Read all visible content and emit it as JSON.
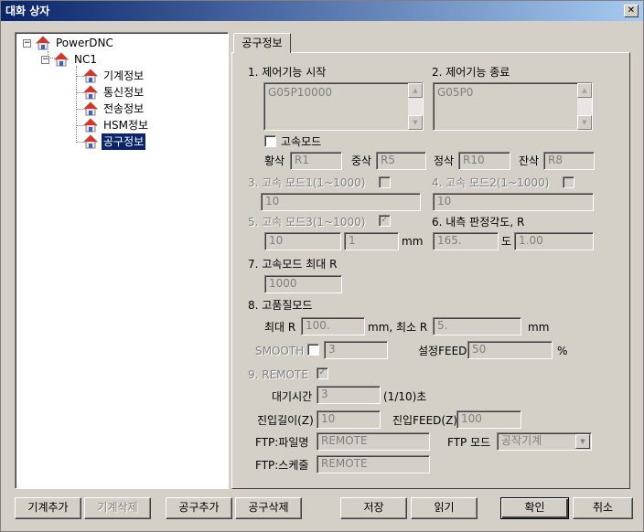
{
  "window": {
    "title": "대화 상자",
    "close_glyph": "✕"
  },
  "tree": {
    "root": "PowerDNC",
    "machine": "NC1",
    "items": [
      "기계정보",
      "통신정보",
      "전송정보",
      "HSM정보",
      "공구정보"
    ],
    "selected_index": 4,
    "expander_glyph": "−"
  },
  "tab": {
    "label": "공구정보"
  },
  "form": {
    "start_label": "1. 제어기능 시작",
    "start_value": "G05P10000",
    "end_label": "2. 제어기능 종료",
    "end_value": "G05P0",
    "high_speed_mode_label": "고속모드",
    "rough_label": "황삭",
    "rough_value": "R1",
    "semi_label": "중삭",
    "semi_value": "R5",
    "finish_label": "정삭",
    "finish_value": "R10",
    "rest_label": "잔삭",
    "rest_value": "R8",
    "mode1_label": "3. 고속 모드1(1~1000)",
    "mode1_value": "10",
    "mode2_label": "4. 고속 모드2(1~1000)",
    "mode2_value": "10",
    "mode3_label": "5. 고속 모드3(1~1000)",
    "mode3_value1": "10",
    "mode3_value2": "1",
    "mode3_unit": "mm",
    "angle_label": "6. 내측 판정각도, R",
    "angle_value": "165.",
    "angle_unit": "도",
    "angle_r_value": "1.00",
    "max_r_label": "7. 고속모드 최대 R",
    "max_r_value": "1000",
    "quality_label": "8. 고품질모드",
    "quality_max_label": "최대 R",
    "quality_max_value": "100.",
    "quality_max_unit": "mm, 최소 R",
    "quality_min_value": "5.",
    "quality_min_unit": "mm",
    "smooth_label": "SMOOTH",
    "smooth_value": "3",
    "feed_label": "설정FEED",
    "feed_value": "50",
    "feed_unit": "%",
    "remote_label": "9. REMOTE",
    "wait_label": "대기시간",
    "wait_value": "3",
    "wait_unit": "(1/10)초",
    "approach_z_label": "진입길이(Z)",
    "approach_z_value": "10",
    "approach_feed_label": "진입FEED(Z)",
    "approach_feed_value": "100",
    "ftp_file_label": "FTP:파일명",
    "ftp_file_value": "REMOTE",
    "ftp_mode_label": "FTP 모드",
    "ftp_mode_value": "공작기계",
    "ftp_sched_label": "FTP:스케줄",
    "ftp_sched_value": "REMOTE"
  },
  "buttons": {
    "add_machine": "기계추가",
    "delete_machine": "기계삭제",
    "add_tool": "공구추가",
    "delete_tool": "공구삭제",
    "save": "저장",
    "read": "읽기",
    "ok": "확인",
    "cancel": "취소"
  },
  "glyphs": {
    "check": "✓",
    "up": "▲",
    "down": "▼"
  }
}
